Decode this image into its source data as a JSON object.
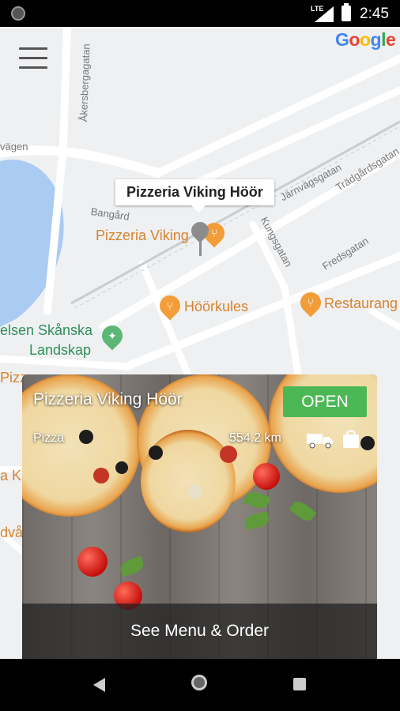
{
  "status_bar": {
    "network": "LTE",
    "time": "2:45"
  },
  "map": {
    "google_logo": [
      "G",
      "o",
      "o",
      "g",
      "l",
      "e"
    ],
    "streets": {
      "akersberga": "Åkersbergagatan",
      "vagen": "vägen",
      "jarnvag": "Järnvägsgatan",
      "tradgards": "Trädgårdsgatan",
      "bangard": "Bangård",
      "kungsgatan": "Kungsgatan",
      "fredsgatan": "Fredsgatan"
    },
    "pois": {
      "pizzeria": "Pizzeria Viking",
      "hoorkules": "Höörkules",
      "restaurang": "Restaurang",
      "skanska_line1": "elsen Skånska",
      "skanska_line2": "Landskap",
      "left_partial_1": "Pizz",
      "left_partial_2": "a K",
      "left_partial_3": "dvå"
    },
    "info_bubble": "Pizzeria Viking Höör"
  },
  "card": {
    "title": "Pizzeria Viking Höör",
    "category": "Pizza",
    "distance": "554.2 km",
    "status": "OPEN",
    "action": "See Menu & Order",
    "icons": [
      "delivery-truck-icon",
      "shopping-bag-icon"
    ],
    "colors": {
      "open": "#4cb855"
    }
  }
}
